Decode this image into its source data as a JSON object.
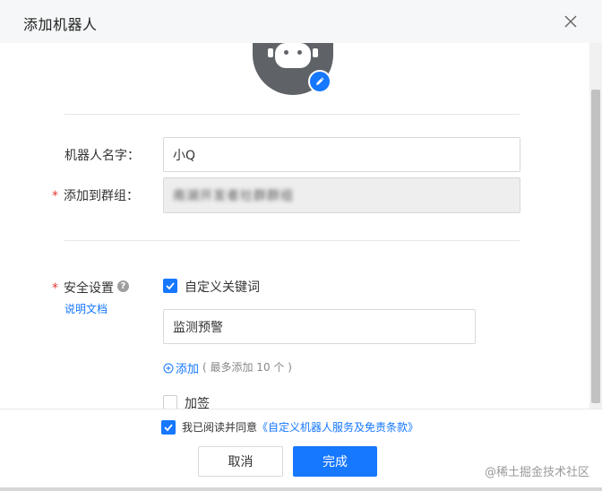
{
  "dialog": {
    "title": "添加机器人"
  },
  "form": {
    "name_label": "机器人名字：",
    "name_value": "小Q",
    "group_label": "添加到群组：",
    "group_value": "南湖开发者社群群组",
    "security_label": "安全设置",
    "doc_link": "说明文档",
    "custom_keyword_label": "自定义关键词",
    "custom_keyword_checked": true,
    "keyword_value": "监测预警",
    "add_link": "添加",
    "add_hint": "( 最多添加 10 个 )",
    "sign_label": "加签",
    "sign_checked": false
  },
  "footer": {
    "agree_prefix": "我已阅读并同意",
    "agree_link": "《自定义机器人服务及免责条款》",
    "agree_checked": true,
    "cancel_label": "取消",
    "confirm_label": "完成"
  },
  "watermark": "@稀土掘金技术社区",
  "colors": {
    "accent": "#1677ff",
    "required": "#e53935",
    "avatar": "#5f6368"
  }
}
